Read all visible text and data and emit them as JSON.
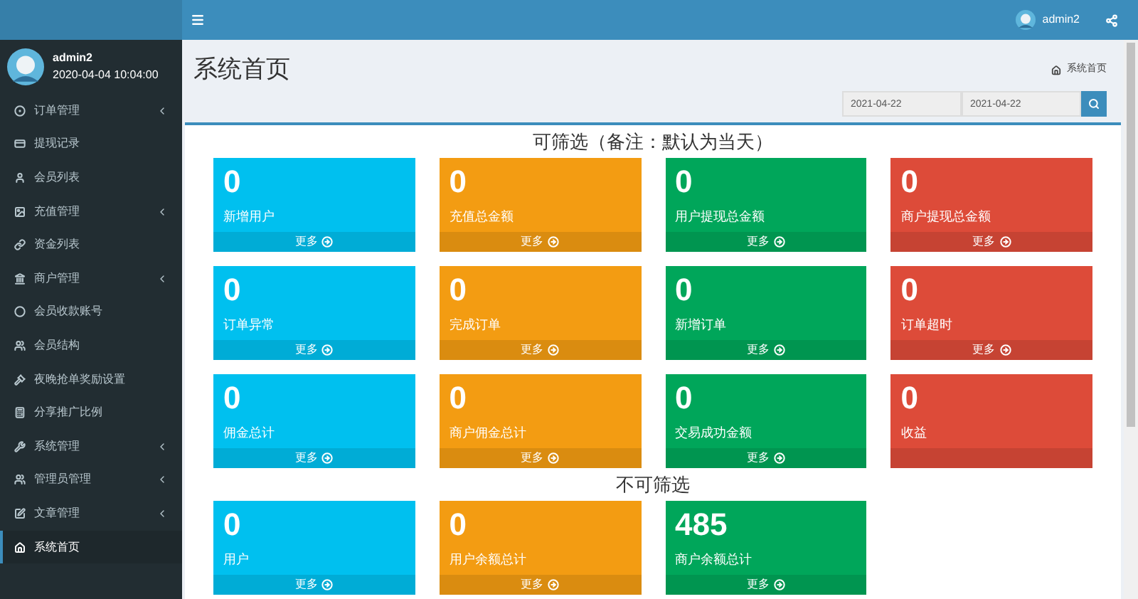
{
  "user": {
    "name": "admin2",
    "time": "2020-04-04 10:04:00"
  },
  "sidebar": {
    "items": [
      {
        "label": "订单管理",
        "expandable": true,
        "selected": false
      },
      {
        "label": "提现记录",
        "expandable": false,
        "selected": false
      },
      {
        "label": "会员列表",
        "expandable": false,
        "selected": false
      },
      {
        "label": "充值管理",
        "expandable": true,
        "selected": false
      },
      {
        "label": "资金列表",
        "expandable": false,
        "selected": false
      },
      {
        "label": "商户管理",
        "expandable": true,
        "selected": false
      },
      {
        "label": "会员收款账号",
        "expandable": false,
        "selected": false
      },
      {
        "label": "会员结构",
        "expandable": false,
        "selected": false
      },
      {
        "label": "夜晚抢单奖励设置",
        "expandable": false,
        "selected": false
      },
      {
        "label": "分享推广比例",
        "expandable": false,
        "selected": false
      },
      {
        "label": "系统管理",
        "expandable": true,
        "selected": false
      },
      {
        "label": "管理员管理",
        "expandable": true,
        "selected": false
      },
      {
        "label": "文章管理",
        "expandable": true,
        "selected": false
      },
      {
        "label": "系统首页",
        "expandable": false,
        "selected": true
      }
    ]
  },
  "header": {
    "user": "admin2"
  },
  "page": {
    "title": "系统首页",
    "breadcrumb": "系统首页"
  },
  "filter": {
    "start": "2021-04-22",
    "end": "2021-04-22"
  },
  "sections": [
    {
      "heading": "可筛选（备注：默认为当天）",
      "cards": [
        {
          "value": "0",
          "label": "新增用户",
          "more": "更多",
          "color": "#00c0ef"
        },
        {
          "value": "0",
          "label": "充值总金额",
          "more": "更多",
          "color": "#f39c12"
        },
        {
          "value": "0",
          "label": "用户提现总金额",
          "more": "更多",
          "color": "#00a65a"
        },
        {
          "value": "0",
          "label": "商户提现总金额",
          "more": "更多",
          "color": "#dd4b39"
        },
        {
          "value": "0",
          "label": "订单异常",
          "more": "更多",
          "color": "#00c0ef"
        },
        {
          "value": "0",
          "label": "完成订单",
          "more": "更多",
          "color": "#f39c12"
        },
        {
          "value": "0",
          "label": "新增订单",
          "more": "更多",
          "color": "#00a65a"
        },
        {
          "value": "0",
          "label": "订单超时",
          "more": "更多",
          "color": "#dd4b39"
        },
        {
          "value": "0",
          "label": "佣金总计",
          "more": "更多",
          "color": "#00c0ef"
        },
        {
          "value": "0",
          "label": "商户佣金总计",
          "more": "更多",
          "color": "#f39c12"
        },
        {
          "value": "0",
          "label": "交易成功金额",
          "more": "更多",
          "color": "#00a65a"
        },
        {
          "value": "0",
          "label": "收益",
          "color": "#dd4b39"
        }
      ]
    },
    {
      "heading": "不可筛选",
      "cards": [
        {
          "value": "0",
          "label": "用户",
          "more": "更多",
          "color": "#00c0ef"
        },
        {
          "value": "0",
          "label": "用户余额总计",
          "more": "更多",
          "color": "#f39c12"
        },
        {
          "value": "485",
          "label": "商户余额总计",
          "more": "更多",
          "color": "#00a65a"
        }
      ]
    }
  ]
}
